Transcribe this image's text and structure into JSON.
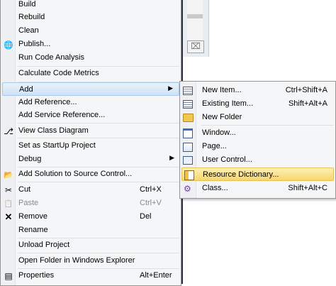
{
  "main_menu": {
    "items": [
      {
        "label": "Build",
        "accel": ""
      },
      {
        "label": "Rebuild",
        "accel": ""
      },
      {
        "label": "Clean",
        "accel": ""
      },
      {
        "label": "Publish...",
        "accel": ""
      },
      {
        "label": "Run Code Analysis",
        "accel": ""
      },
      {
        "label": "Calculate Code Metrics",
        "accel": ""
      },
      {
        "label": "Add",
        "accel": ""
      },
      {
        "label": "Add Reference...",
        "accel": ""
      },
      {
        "label": "Add Service Reference...",
        "accel": ""
      },
      {
        "label": "View Class Diagram",
        "accel": ""
      },
      {
        "label": "Set as StartUp Project",
        "accel": ""
      },
      {
        "label": "Debug",
        "accel": ""
      },
      {
        "label": "Add Solution to Source Control...",
        "accel": ""
      },
      {
        "label": "Cut",
        "accel": "Ctrl+X"
      },
      {
        "label": "Paste",
        "accel": "Ctrl+V"
      },
      {
        "label": "Remove",
        "accel": "Del"
      },
      {
        "label": "Rename",
        "accel": ""
      },
      {
        "label": "Unload Project",
        "accel": ""
      },
      {
        "label": "Open Folder in Windows Explorer",
        "accel": ""
      },
      {
        "label": "Properties",
        "accel": "Alt+Enter"
      }
    ]
  },
  "sub_menu": {
    "items": [
      {
        "label": "New Item...",
        "accel": "Ctrl+Shift+A"
      },
      {
        "label": "Existing Item...",
        "accel": "Shift+Alt+A"
      },
      {
        "label": "New Folder",
        "accel": ""
      },
      {
        "label": "Window...",
        "accel": ""
      },
      {
        "label": "Page...",
        "accel": ""
      },
      {
        "label": "User Control...",
        "accel": ""
      },
      {
        "label": "Resource Dictionary...",
        "accel": ""
      },
      {
        "label": "Class...",
        "accel": "Shift+Alt+C"
      }
    ]
  },
  "background": {
    "close_glyph": "⌧"
  },
  "icons": {
    "submenu_arrow": "▶",
    "publish": "🌐",
    "class_diagram": "⎇",
    "source_control": "📂",
    "cut": "✂",
    "paste": "📋",
    "remove": "✕",
    "properties": "▤"
  },
  "colors": {
    "highlight_blue": "#cfe2f6",
    "highlight_gold": "#f7d66b",
    "menu_bg": "#f5f6f7"
  }
}
